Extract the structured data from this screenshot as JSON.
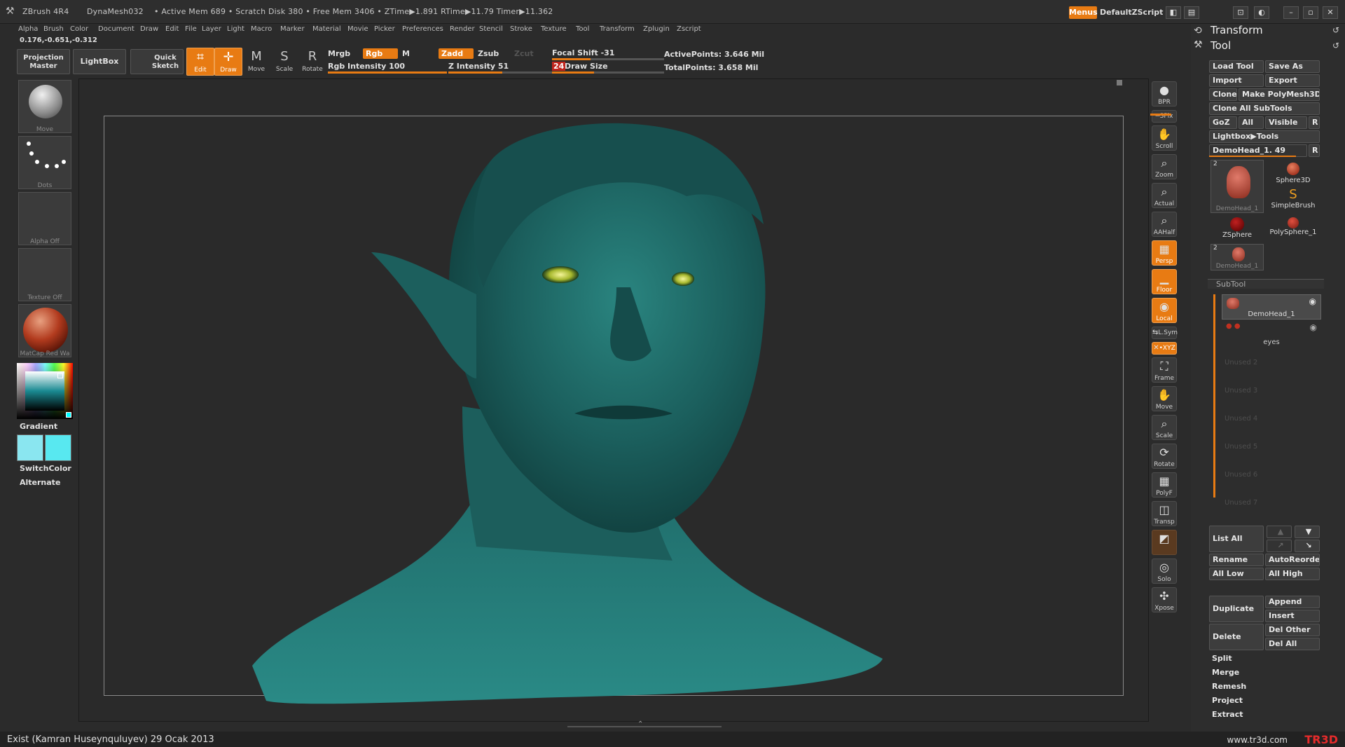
{
  "titlebar": {
    "app": "ZBrush 4R4",
    "tool": "DynaMesh032",
    "stats": "• Active Mem 689  • Scratch Disk 380  • Free Mem 3406  • ZTime▶1.891 RTime▶11.79 Timer▶11.362",
    "menus_btn": "Menus",
    "script": "DefaultZScript"
  },
  "menubar": [
    "Alpha",
    "Brush",
    "Color",
    "Document",
    "Draw",
    "Edit",
    "File",
    "Layer",
    "Light",
    "Macro",
    "Marker",
    "Material",
    "Movie",
    "Picker",
    "Preferences",
    "Render",
    "Stencil",
    "Stroke",
    "Texture",
    "Tool",
    "Transform",
    "Zplugin",
    "Zscript"
  ],
  "coords": "0.176,-0.651,-0.312",
  "toolbar": {
    "projection_master": "Projection Master",
    "lightbox": "LightBox",
    "quick_sketch": "Quick Sketch",
    "edit": "Edit",
    "draw": "Draw",
    "move": "Move",
    "scale": "Scale",
    "rotate": "Rotate",
    "mrgb": "Mrgb",
    "rgb": "Rgb",
    "m": "M",
    "rgb_intensity": "Rgb  Intensity 100",
    "rgb_intensity_value": 100,
    "zadd": "Zadd",
    "zsub": "Zsub",
    "zcut": "Zcut",
    "z_intensity": "Z  Intensity 51",
    "z_intensity_value": 51,
    "focal_shift": "Focal  Shift -31",
    "focal_shift_value": -31,
    "draw_size_num": "24",
    "draw_size": "Draw  Size",
    "active_points": "ActivePoints: 3.646  Mil",
    "total_points": "TotalPoints: 3.658  Mil"
  },
  "left_shelf": {
    "brush": "Move",
    "stroke": "Dots",
    "alpha": "Alpha  Off",
    "texture": "Texture  Off",
    "material": "MatCap  Red  Wa",
    "gradient": "Gradient",
    "switchcolor": "SwitchColor",
    "alternate": "Alternate",
    "main_color": "#8ae6f0",
    "secondary_color": "#58e8f0"
  },
  "right_shelf": [
    {
      "id": "bpr",
      "label": "BPR",
      "icon": "sphere-icon"
    },
    {
      "id": "spix",
      "label": "SPix",
      "icon": "slider-icon"
    },
    {
      "id": "scroll",
      "label": "Scroll",
      "icon": "hand-icon"
    },
    {
      "id": "zoom",
      "label": "Zoom",
      "icon": "magnifier-icon"
    },
    {
      "id": "actual",
      "label": "Actual",
      "icon": "magnifier-icon"
    },
    {
      "id": "aahalf",
      "label": "AAHalf",
      "icon": "magnifier-icon"
    },
    {
      "id": "persp",
      "label": "Persp",
      "icon": "grid-icon"
    },
    {
      "id": "floor",
      "label": "Floor",
      "icon": "floor-icon"
    },
    {
      "id": "local",
      "label": "Local",
      "icon": "local-icon"
    },
    {
      "id": "lsym",
      "label": "L.Sym",
      "icon": "symmetry-icon"
    },
    {
      "id": "xyz",
      "label": "•XYZ",
      "icon": "xyz-icon"
    },
    {
      "id": "frame",
      "label": "Frame",
      "icon": "frame-icon"
    },
    {
      "id": "move",
      "label": "Move",
      "icon": "hand-icon"
    },
    {
      "id": "scale",
      "label": "Scale",
      "icon": "magnifier-icon"
    },
    {
      "id": "rotate",
      "label": "Rotate",
      "icon": "rotate-icon"
    },
    {
      "id": "polyf",
      "label": "PolyF",
      "icon": "grid-icon"
    },
    {
      "id": "transp",
      "label": "Transp",
      "icon": "transp-icon"
    },
    {
      "id": "ghost",
      "label": "",
      "icon": "ghost-icon"
    },
    {
      "id": "solo",
      "label": "Solo",
      "icon": "solo-icon"
    },
    {
      "id": "xpose",
      "label": "Xpose",
      "icon": "xpose-icon"
    }
  ],
  "palette": {
    "transform": "Transform",
    "tool": "Tool",
    "load_tool": "Load Tool",
    "save_as": "Save As",
    "import": "Import",
    "export": "Export",
    "clone": "Clone",
    "make_polymesh": "Make PolyMesh3D",
    "clone_all": "Clone  All SubTools",
    "goz": "GoZ",
    "all": "All",
    "visible": "Visible",
    "r": "R",
    "lightbox_tools": "Lightbox▶Tools",
    "current_tool": "DemoHead_1. 49",
    "thumbs": [
      {
        "label": "DemoHead_1",
        "count": "2"
      },
      {
        "label": "Sphere3D"
      },
      {
        "label": "SimpleBrush"
      },
      {
        "label": "ZSphere"
      },
      {
        "label": "PolySphere_1"
      },
      {
        "label": "DemoHead_1",
        "count": "2"
      }
    ],
    "subtool": "SubTool",
    "subtools": [
      "DemoHead_1",
      "eyes"
    ],
    "unused": [
      "Unused  2",
      "Unused  3",
      "Unused  4",
      "Unused  5",
      "Unused  6",
      "Unused  7"
    ],
    "list_all": "List  All",
    "rename": "Rename",
    "autoreorder": "AutoReorder",
    "all_low": "All Low",
    "all_high": "All High",
    "duplicate": "Duplicate",
    "append": "Append",
    "insert": "Insert",
    "delete": "Delete",
    "del_other": "Del Other",
    "del_all": "Del All",
    "split": "Split",
    "merge": "Merge",
    "remesh": "Remesh",
    "project": "Project",
    "extract": "Extract"
  },
  "footer": {
    "credit": "Exist (Kamran Huseynquluyev)  29 Ocak 2013",
    "site": "www.tr3d.com",
    "logo": "TR3D"
  },
  "colors": {
    "accent": "#e87b13",
    "model": "#1f6a68"
  }
}
